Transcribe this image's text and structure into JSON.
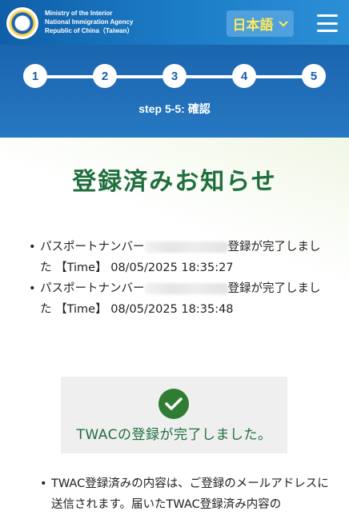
{
  "header": {
    "agency_lines": [
      "Ministry of the Interior",
      "National Immigration Agency",
      "Republic of China（Taiwan）"
    ],
    "language_label": "日本語",
    "language_icon": "chevron-down-icon",
    "menu_icon": "hamburger-menu-icon"
  },
  "stepper": {
    "steps": [
      "1",
      "2",
      "3",
      "4",
      "5"
    ],
    "current_label": "step 5-5: 確認"
  },
  "main": {
    "title": "登録済みお知らせ",
    "records": [
      {
        "prefix": "パスポートナンバー",
        "suffix": "登録が完了しました",
        "time_label": "【Time】",
        "time": "08/05/2025 18:35:27"
      },
      {
        "prefix": "パスポートナンバー",
        "suffix": "登録が完了しました",
        "time_label": "【Time】",
        "time": "08/05/2025 18:35:48"
      }
    ],
    "success_message": "TWACの登録が完了しました。",
    "success_icon": "check-circle-icon",
    "notes": [
      "TWAC登録済みの内容は、ご登録のメールアドレスに送信されます。届いたTWAC登録済み内容の"
    ]
  },
  "colors": {
    "header_bg": "#1b64ae",
    "language_text": "#ffe95a",
    "title_green": "#1f6f3d",
    "check_green": "#2e7d32"
  }
}
